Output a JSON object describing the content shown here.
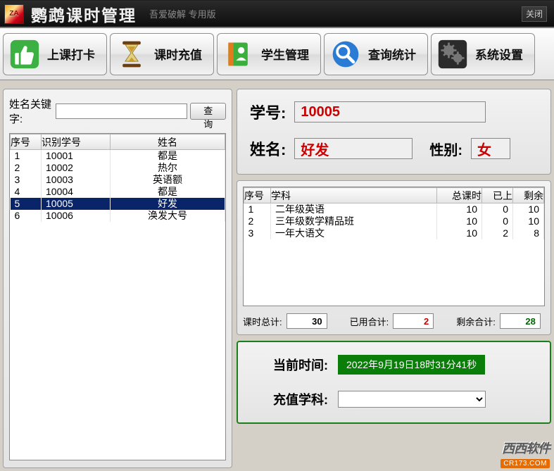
{
  "header": {
    "logo_text": "ZA",
    "title": "鹦鹉课时管理",
    "subtitle": "吾爱破解 专用版",
    "close_label": "关闭"
  },
  "toolbar": {
    "check_in": "上课打卡",
    "topup": "课时充值",
    "student_mgmt": "学生管理",
    "query_stats": "查询统计",
    "system_settings": "系统设置"
  },
  "left": {
    "search_label": "姓名关键字:",
    "search_value": "",
    "search_btn": "查询",
    "columns": {
      "seq": "序号",
      "sid": "识别学号",
      "name": "姓名"
    },
    "rows": [
      {
        "seq": "1",
        "sid": "10001",
        "name": "都是"
      },
      {
        "seq": "2",
        "sid": "10002",
        "name": "热尔"
      },
      {
        "seq": "3",
        "sid": "10003",
        "name": "英语额"
      },
      {
        "seq": "4",
        "sid": "10004",
        "name": "都是"
      },
      {
        "seq": "5",
        "sid": "10005",
        "name": "好发"
      },
      {
        "seq": "6",
        "sid": "10006",
        "name": "涣发大号"
      }
    ],
    "selected_index": 4
  },
  "info": {
    "id_label": "学号:",
    "id_value": "10005",
    "name_label": "姓名:",
    "name_value": "好发",
    "sex_label": "性别:",
    "sex_value": "女"
  },
  "courses": {
    "columns": {
      "seq": "序号",
      "subject": "学科",
      "total": "总课时",
      "done": "已上",
      "remain": "剩余"
    },
    "rows": [
      {
        "seq": "1",
        "subject": "二年级英语",
        "total": "10",
        "done": "0",
        "remain": "10"
      },
      {
        "seq": "2",
        "subject": "三年级数学精品班",
        "total": "10",
        "done": "0",
        "remain": "10"
      },
      {
        "seq": "3",
        "subject": "一年大语文",
        "total": "10",
        "done": "2",
        "remain": "8"
      }
    ],
    "totals": {
      "total_label": "课时总计:",
      "total_value": "30",
      "done_label": "已用合计:",
      "done_value": "2",
      "remain_label": "剩余合计:",
      "remain_value": "28"
    }
  },
  "recharge": {
    "time_label": "当前时间:",
    "time_value": "2022年9月19日18时31分41秒",
    "subject_label": "充值学科:",
    "subject_value": ""
  },
  "watermark": {
    "line1": "西西软件",
    "line2": "CR173.COM"
  }
}
